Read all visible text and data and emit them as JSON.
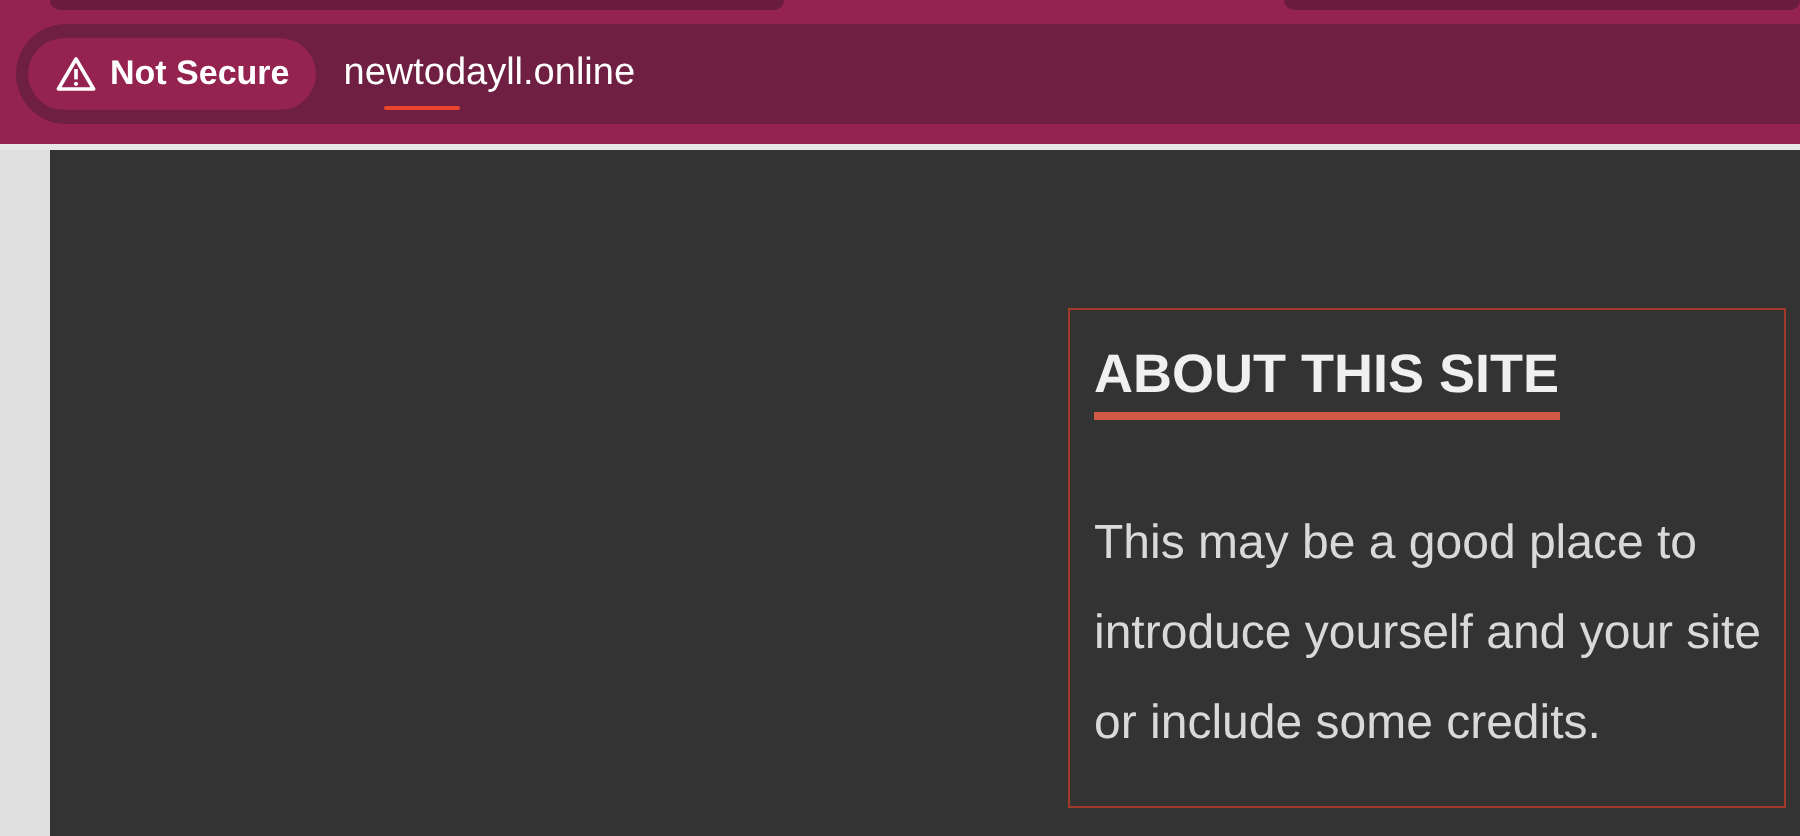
{
  "address_bar": {
    "security_label": "Not Secure",
    "url": "newtodayll.online"
  },
  "widget": {
    "title": "ABOUT THIS SITE",
    "text": "This may be a good place to introduce yourself and your site or include some credits."
  }
}
